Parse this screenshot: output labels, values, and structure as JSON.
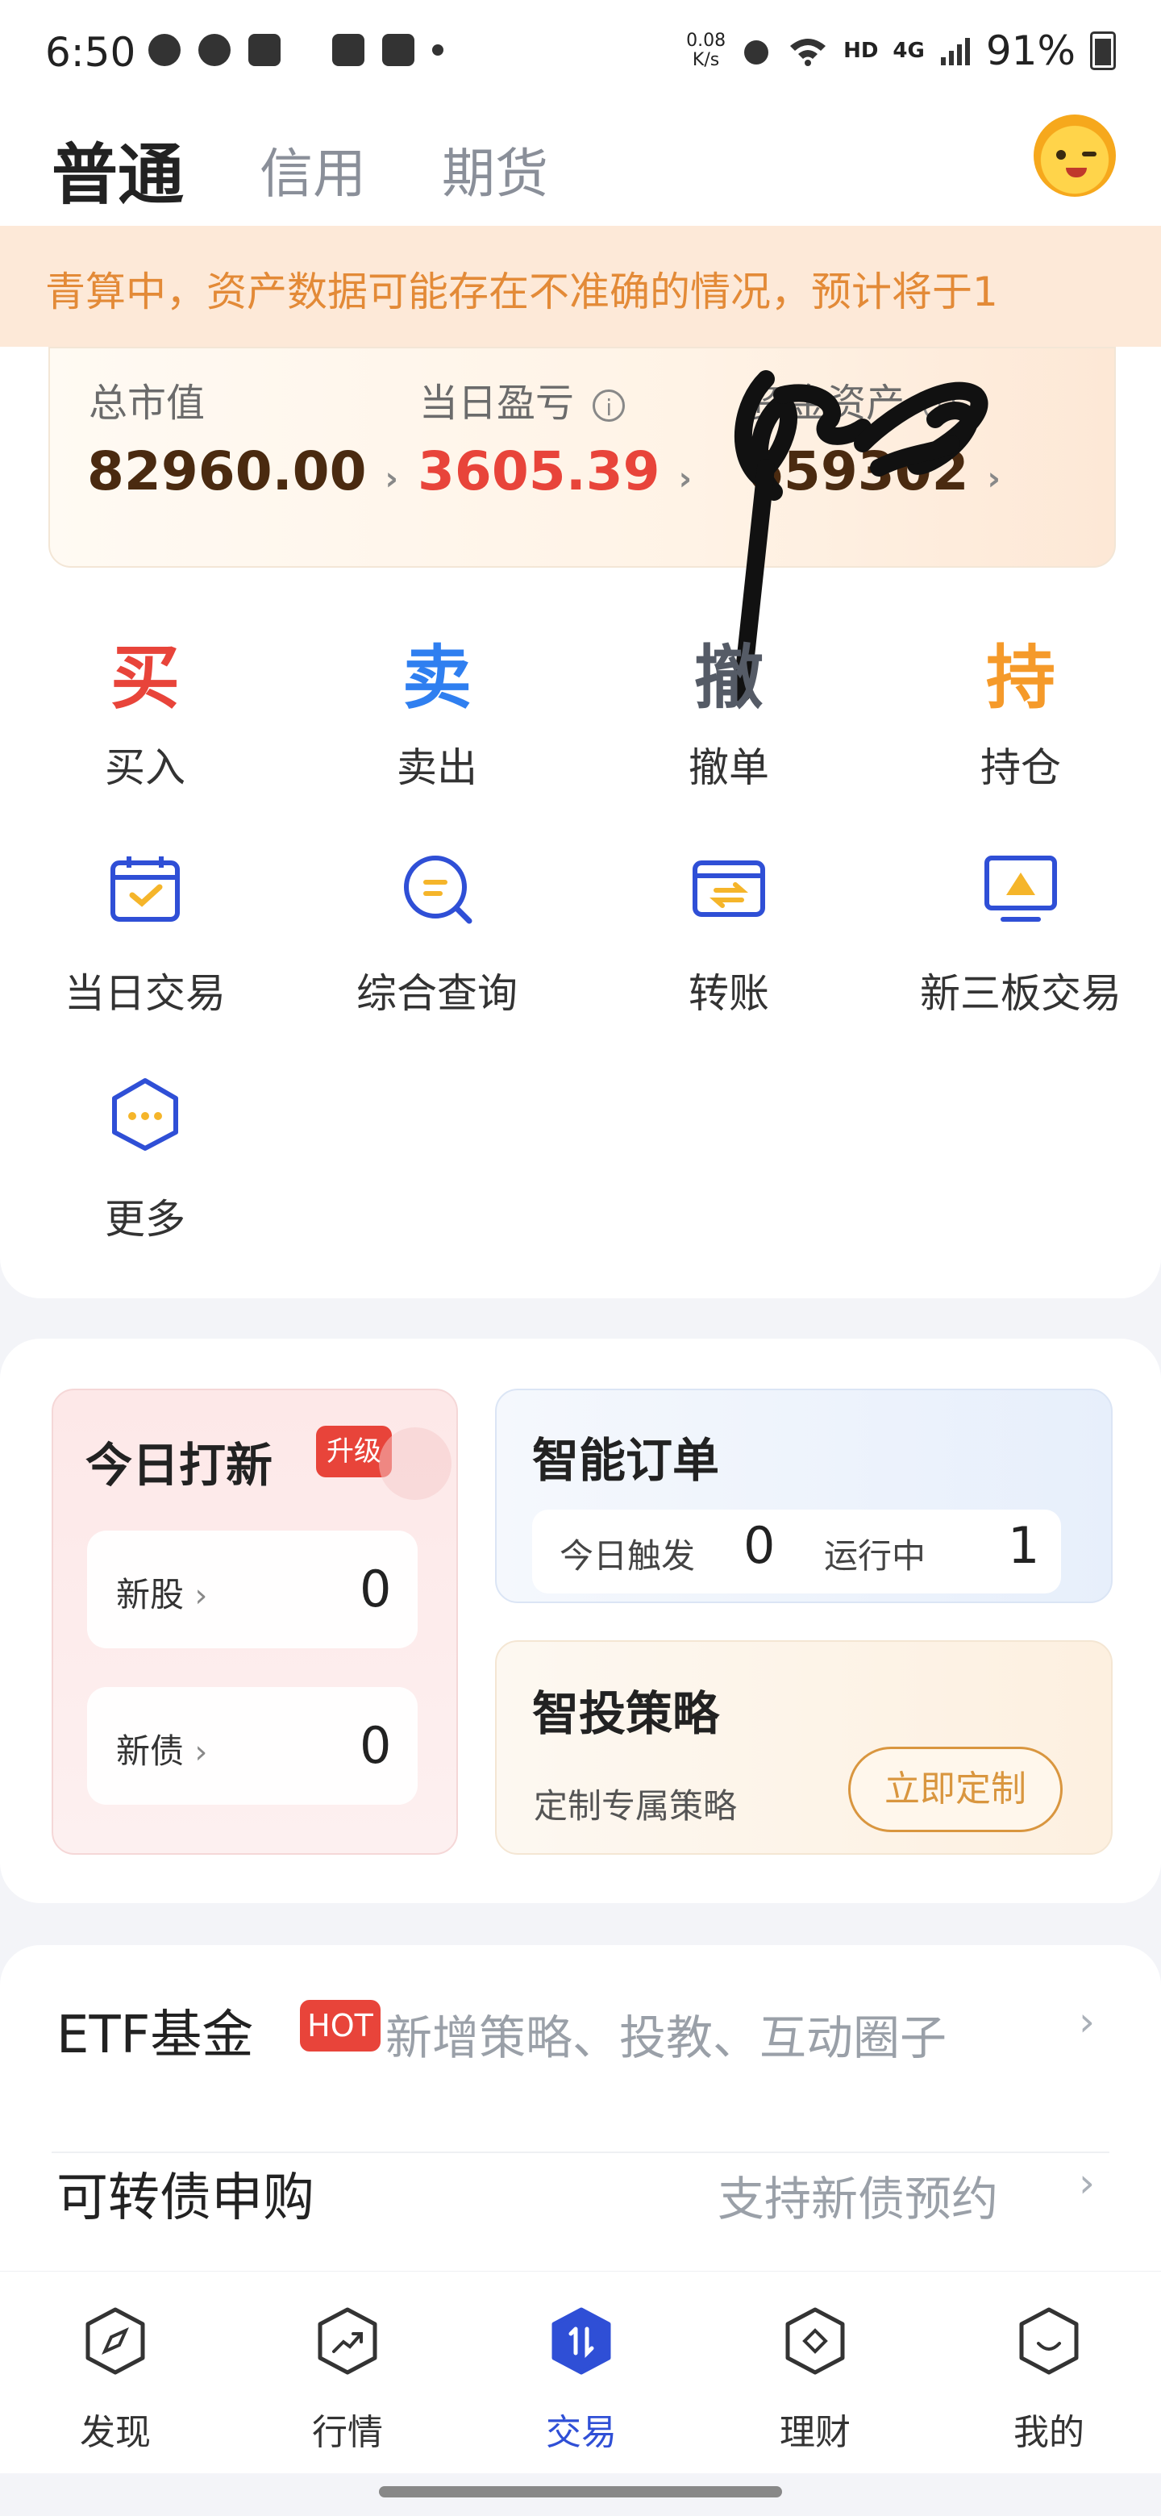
{
  "status_bar": {
    "time": "6:50",
    "net_speed": "0.08",
    "net_unit": "K/s",
    "network": "HD",
    "signal": "4G",
    "battery": "91%",
    "icons": [
      "chat-bubble-icon",
      "wechat-icon",
      "s-app-icon",
      "image-icon",
      "checkbox-icon",
      "dot-icon",
      "alarm-icon",
      "wifi-icon",
      "signal-icon",
      "battery-icon"
    ]
  },
  "header": {
    "tabs": [
      "普通",
      "信用",
      "期货"
    ],
    "active_tab": "普通"
  },
  "notice": {
    "text": "青算中，资产数据可能存在不准确的情况，预计将于1"
  },
  "summary": {
    "total_market_value": {
      "label": "总市值",
      "value": "82960.00"
    },
    "daily_pnl": {
      "label": "当日盈亏",
      "value": "3605.39"
    },
    "fund_assets": {
      "label": "资金资产",
      "value": "659302"
    }
  },
  "quick_actions": [
    {
      "glyph": "买",
      "label": "买入",
      "color": "#e8443a"
    },
    {
      "glyph": "卖",
      "label": "卖出",
      "color": "#2f7ff0"
    },
    {
      "glyph": "撤",
      "label": "撤单",
      "color": "#555b66"
    },
    {
      "glyph": "持",
      "label": "持仓",
      "color": "#f59a2a"
    }
  ],
  "tools": [
    {
      "label": "当日交易",
      "icon": "calendar-check-icon"
    },
    {
      "label": "综合查询",
      "icon": "search-query-icon"
    },
    {
      "label": "转账",
      "icon": "transfer-card-icon"
    },
    {
      "label": "新三板交易",
      "icon": "monitor-chart-icon"
    },
    {
      "label": "更多",
      "icon": "more-hexagon-icon"
    }
  ],
  "ipo": {
    "title": "今日打新",
    "badge": "升级",
    "rows": [
      {
        "label": "新股",
        "value": "0"
      },
      {
        "label": "新债",
        "value": "0"
      }
    ]
  },
  "smart_order": {
    "title": "智能订单",
    "triggered_label": "今日触发",
    "triggered_value": "0",
    "running_label": "运行中",
    "running_value": "1"
  },
  "strategy": {
    "title": "智投策略",
    "subtitle": "定制专属策略",
    "button": "立即定制"
  },
  "list": [
    {
      "title": "ETF基金",
      "badge": "HOT",
      "subtitle": "新增策略、投教、互动圈子"
    },
    {
      "title": "可转债申购",
      "subtitle": "支持新债预约"
    }
  ],
  "bottom_nav": [
    {
      "label": "发现",
      "icon": "compass-hexagon-icon"
    },
    {
      "label": "行情",
      "icon": "trend-hexagon-icon"
    },
    {
      "label": "交易",
      "icon": "trade-hexagon-icon",
      "active": true
    },
    {
      "label": "理财",
      "icon": "diamond-hexagon-icon"
    },
    {
      "label": "我的",
      "icon": "smile-hexagon-icon"
    }
  ],
  "colors": {
    "accent_blue": "#2f4fd6",
    "profit_red": "#e8443a",
    "notice_orange": "#e38a37"
  }
}
